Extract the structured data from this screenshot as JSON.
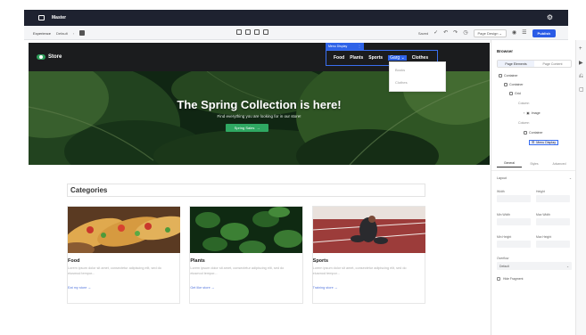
{
  "app": {
    "title": "Master",
    "gear_icon": "gear-icon"
  },
  "toolbar": {
    "experience_label": "Experience",
    "experience_value": "Default",
    "chevron": "›",
    "saved_label": "Saved",
    "page_design_label": "Page Design",
    "page_design_chevron": "⌄",
    "publish_label": "Publish",
    "undo_icon": "↶",
    "redo_icon": "↷",
    "history_icon": "◷",
    "preview_icon": "◉",
    "settings_icon": "☰"
  },
  "site": {
    "brand": "Store",
    "menu_tag": "Menu Display",
    "menu_tag_handle": "⋮",
    "nav_links": [
      "Food",
      "Plants",
      "Sports",
      "Clothes"
    ],
    "more_link": "Garg ⌄",
    "dropdown_items": [
      "Books",
      "Clothes"
    ]
  },
  "hero": {
    "title": "The Spring Collection is here!",
    "subtitle": "Find everything you are looking for in our store!",
    "button_label": "Spring Sales",
    "button_arrow": "→"
  },
  "categories": {
    "title": "Categories",
    "items": [
      {
        "title": "Food",
        "desc": "Lorem ipsum dolor sit amet, consectetur adipiscing elit, sed do eiusmod tempor...",
        "link": "Eat my store →"
      },
      {
        "title": "Plants",
        "desc": "Lorem ipsum dolor sit amet, consectetur adipiscing elit, sed do eiusmod tempor...",
        "link": "Get like store →"
      },
      {
        "title": "Sports",
        "desc": "Lorem ipsum dolor sit amet, consectetur adipiscing elit, sed do eiusmod tempor...",
        "link": "Training store →"
      }
    ]
  },
  "right_panel": {
    "title": "Browser",
    "tabs": [
      "Page Elements",
      "Page Content"
    ],
    "tree": [
      {
        "label": "Container"
      },
      {
        "label": "Container"
      },
      {
        "label": "Grid"
      },
      {
        "label": "Column"
      },
      {
        "label": "Image"
      },
      {
        "label": "Column"
      },
      {
        "label": "Container"
      },
      {
        "label": "Menu Display"
      }
    ],
    "style_tabs": [
      "General",
      "Styles",
      "Advanced"
    ],
    "layout_label": "Layout",
    "layout_chevron": "⌄",
    "fields": [
      "Width",
      "Height",
      "Min Width",
      "Max Width",
      "Min Height",
      "Max Height"
    ],
    "overflow_label": "Overflow",
    "overflow_value": "Default",
    "overflow_chevron": "⌄",
    "hide_label": "Hide Fragment"
  },
  "icon_strip": [
    "+",
    "▶",
    "⎌",
    "▢"
  ]
}
